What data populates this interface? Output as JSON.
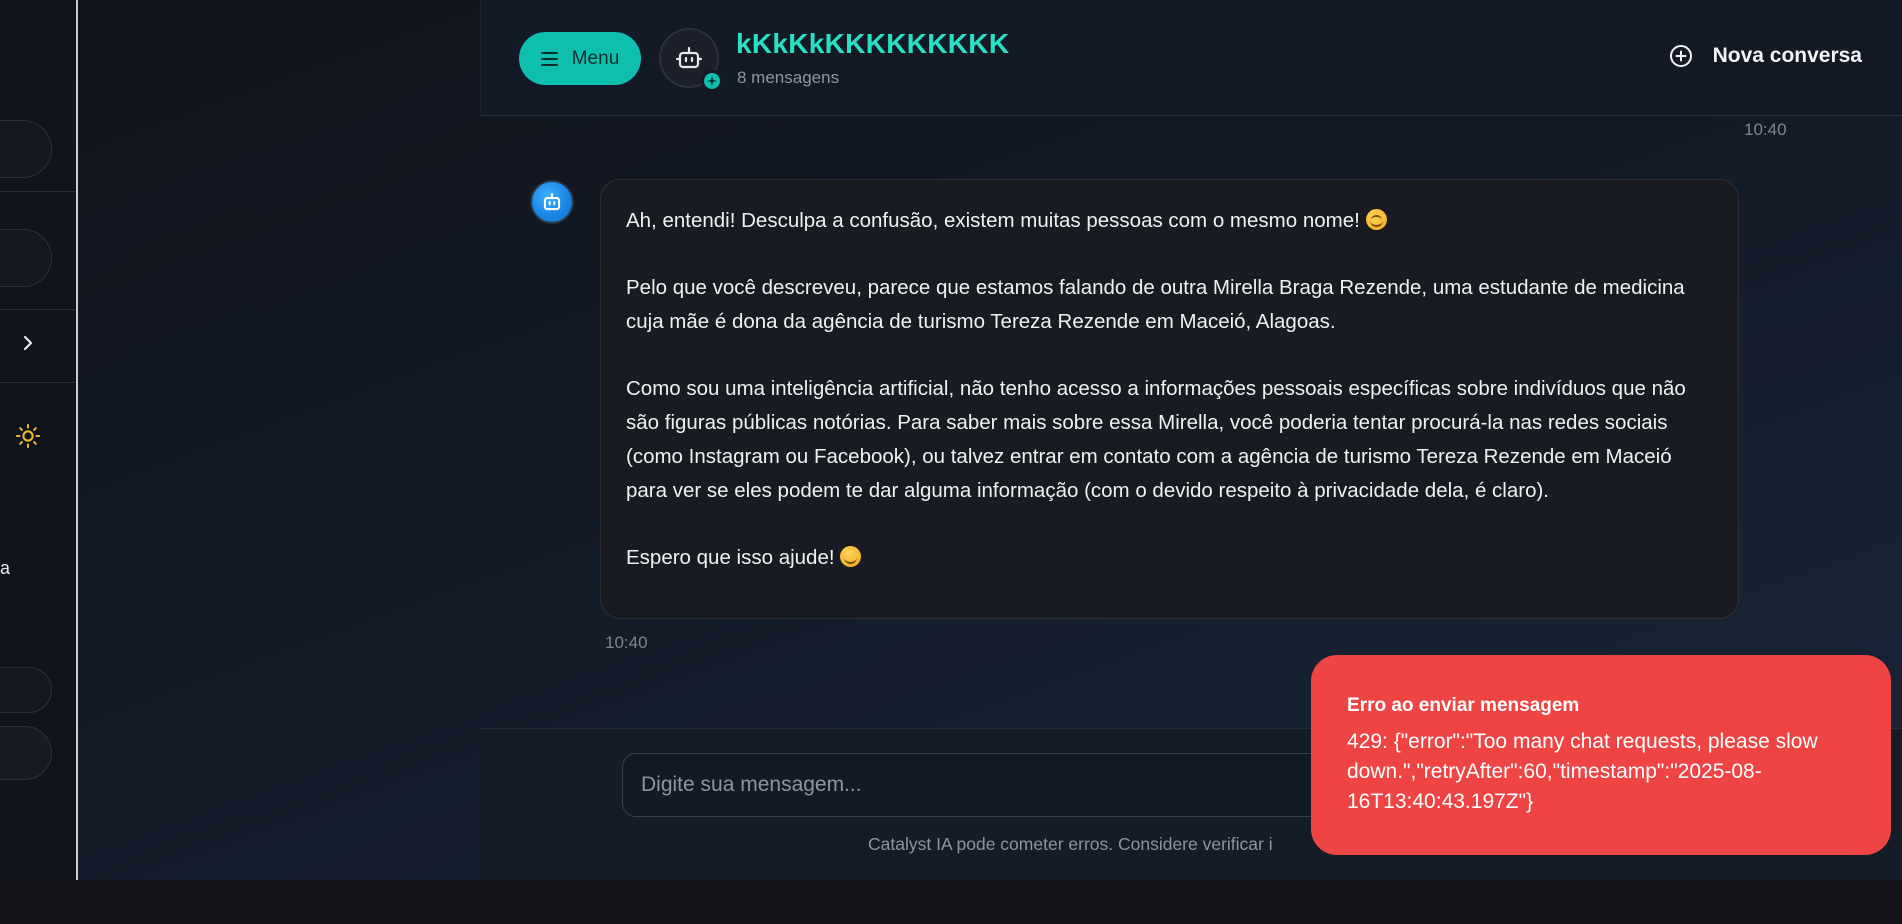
{
  "sidebar": {
    "partial_text": "a"
  },
  "header": {
    "menu_label": "Menu",
    "chat_title": "kKkKkKKKKKKKKK",
    "message_count": "8 mensagens",
    "new_chat_label": "Nova conversa"
  },
  "messages": [
    {
      "role": "user",
      "timestamp": "10:40"
    },
    {
      "role": "assistant",
      "paragraphs": [
        "Ah, entendi! Desculpa a confusão, existem muitas pessoas com o mesmo nome!",
        "Pelo que você descreveu, parece que estamos falando de outra Mirella Braga Rezende, uma estudante de medicina cuja mãe é dona da agência de turismo Tereza Rezende em Maceió, Alagoas.",
        "Como sou uma inteligência artificial, não tenho acesso a informações pessoais específicas sobre indivíduos que não são figuras públicas notórias. Para saber mais sobre essa Mirella, você poderia tentar procurá-la nas redes sociais (como Instagram ou Facebook), ou talvez entrar em contato com a agência de turismo Tereza Rezende em Maceió para ver se eles podem te dar alguma informação (com o devido respeito à privacidade dela, é claro).",
        "Espero que isso ajude!"
      ],
      "timestamp": "10:40"
    }
  ],
  "composer": {
    "placeholder": "Digite sua mensagem...",
    "disclaimer": "Catalyst IA pode cometer erros. Considere verificar i"
  },
  "toast": {
    "title": "Erro ao enviar mensagem",
    "body": "429: {\"error\":\"Too many chat requests, please slow down.\",\"retryAfter\":60,\"timestamp\":\"2025-08-16T13:40:43.197Z\"}"
  },
  "icons": [
    "menu-icon",
    "robot-icon",
    "sparkle-icon",
    "plus-circle-icon",
    "chevron-right-icon",
    "sun-icon",
    "smile-emoji",
    "wink-emoji"
  ],
  "colors": {
    "accent": "#0fbfae",
    "title": "#27e0c6",
    "error": "#ef4444",
    "sun": "#f5b82e",
    "avatar": "#1a86e6"
  }
}
